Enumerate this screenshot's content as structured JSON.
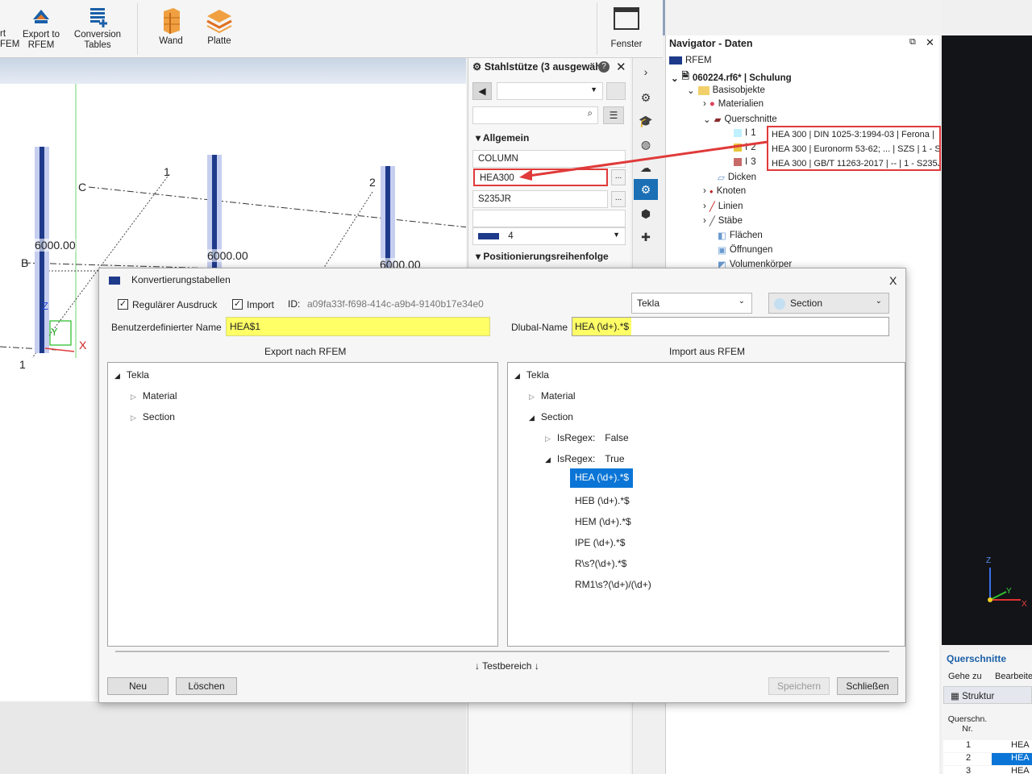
{
  "ribbon": {
    "partial_label_1": "rt",
    "partial_label_2": "FEM",
    "export_line1": "Export to",
    "export_line2": "RFEM",
    "conversion_line1": "Conversion",
    "conversion_line2": "Tables",
    "wand": "Wand",
    "platte": "Platte",
    "fenster": "Fenster"
  },
  "viewport": {
    "dims": [
      "6000.00",
      "6000.00",
      "6000.00"
    ],
    "grid_labels": [
      "1",
      "2",
      "C",
      "B",
      "1"
    ],
    "axes": {
      "z": "Z",
      "y": "Y",
      "x": "X"
    }
  },
  "props": {
    "title": "Stahlstütze (3 ausgewäh",
    "help": "?",
    "close": "✕",
    "section_allgemein": "Allgemein",
    "type": "COLUMN",
    "profile": "HEA300",
    "material": "S235JR",
    "color_value": "4",
    "section_pos": "Positionierungsreihenfolge",
    "dots": "..."
  },
  "navigator": {
    "title": "Navigator - Daten",
    "root": "RFEM",
    "file": "060224.rf6* | Schulung",
    "basis": "Basisobjekte",
    "materialien": "Materialien",
    "querschnitte": "Querschnitte",
    "qs_items": [
      {
        "nr": "1",
        "text": "HEA 300 | DIN 1025-3:1994-03 | Ferona | "
      },
      {
        "nr": "2",
        "text": "HEA 300 | Euronorm 53-62; ... | SZS | 1 - S"
      },
      {
        "nr": "3",
        "text": "HEA 300 | GB/T 11263-2017 | -- | 1 - S235J"
      }
    ],
    "dicken": "Dicken",
    "knoten": "Knoten",
    "linien": "Linien",
    "staebe": "Stäbe",
    "flaechen": "Flächen",
    "oeffnungen": "Öffnungen",
    "volumen": "Volumenkörper"
  },
  "colors": {
    "highlight": "#ffff66",
    "selection": "#0a75d6",
    "callout": "#e03a3a",
    "accent_blue": "#1a5fa8"
  },
  "rightpanel": {
    "axes": {
      "z": "Z",
      "y": "Y",
      "x": "X"
    },
    "title": "Querschnitte",
    "menu1": "Gehe zu",
    "menu2": "Bearbeite",
    "struktur": "Struktur",
    "col_header_1": "Querschn.",
    "col_header_2": "Nr.",
    "rows": [
      {
        "nr": "1",
        "val": "HEA"
      },
      {
        "nr": "2",
        "val": "HEA"
      },
      {
        "nr": "3",
        "val": "HEA"
      }
    ]
  },
  "dialog": {
    "title": "Konvertierungstabellen",
    "close": "X",
    "regex_label": "Regulärer Ausdruck",
    "import_label": "Import",
    "id_label": "ID:",
    "id_value": "a09fa33f-f698-414c-a9b4-9140b17e34e0",
    "source_select": "Tekla",
    "type_select": "Section",
    "custom_name_label": "Benutzerdefinierter Name",
    "custom_name_value": "HEA$1",
    "dlubal_label": "Dlubal-Name",
    "dlubal_value": "HEA (\\d+).*$",
    "export_header": "Export nach RFEM",
    "import_header": "Import aus RFEM",
    "export_tree": {
      "root": "Tekla",
      "material": "Material",
      "section": "Section"
    },
    "import_tree": {
      "root": "Tekla",
      "material": "Material",
      "section": "Section",
      "isregex_label": "IsRegex:",
      "false": "False",
      "true": "True",
      "patterns": [
        "HEA (\\d+).*$",
        "HEB (\\d+).*$",
        "HEM (\\d+).*$",
        "IPE (\\d+).*$",
        "R\\s?(\\d+).*$",
        "RM1\\s?(\\d+)/(\\d+)"
      ]
    },
    "testbereich": "↓ Testbereich ↓",
    "btn_neu": "Neu",
    "btn_loeschen": "Löschen",
    "btn_speichern": "Speichern",
    "btn_schliessen": "Schließen"
  }
}
